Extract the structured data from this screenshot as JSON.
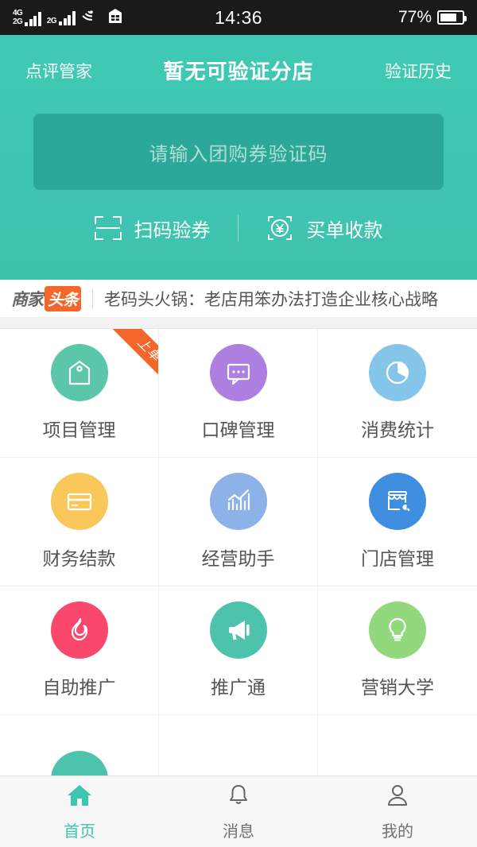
{
  "statusbar": {
    "sim1_label": "4G",
    "sim2_label": "2G",
    "sim3_label": "2G",
    "time": "14:36",
    "battery_percent": "77%",
    "battery_level": 75,
    "wifi_icon": "wifi-icon",
    "alarm_icon": "building-icon"
  },
  "header": {
    "left_label": "点评管家",
    "title": "暂无可验证分店",
    "right_label": "验证历史",
    "input": {
      "value": "",
      "placeholder": "请输入团购券验证码"
    },
    "actions": [
      {
        "label": "扫码验券",
        "icon": "scan-code-icon"
      },
      {
        "label": "买单收款",
        "icon": "yuan-scan-icon"
      }
    ],
    "bg_color": "#3ec6b0",
    "input_bg_color": "#2ba89a"
  },
  "news": {
    "logo_part1": "商家",
    "logo_part2": "头条",
    "logo_accent_color": "#f4662a",
    "headline": "老码头火锅：老店用笨办法打造企业核心战略"
  },
  "grid": {
    "items": [
      {
        "label": "项目管理",
        "icon": "price-tag-icon",
        "color": "#5bc6aa",
        "badge": "上单"
      },
      {
        "label": "口碑管理",
        "icon": "speech-bubble-icon",
        "color": "#ac7fe0",
        "badge": ""
      },
      {
        "label": "消费统计",
        "icon": "pie-chart-icon",
        "color": "#86c5ea",
        "badge": ""
      },
      {
        "label": "财务结款",
        "icon": "credit-card-icon",
        "color": "#fac košice",
        "badge": ""
      },
      {
        "label": "经营助手",
        "icon": "bar-chart-icon",
        "color": "#8cb2e8",
        "badge": ""
      },
      {
        "label": "门店管理",
        "icon": "storefront-wrench-icon",
        "color": "#3f8ee0",
        "badge": ""
      },
      {
        "label": "自助推广",
        "icon": "flame-icon",
        "color": "#f9486b",
        "badge": ""
      },
      {
        "label": "推广通",
        "icon": "megaphone-icon",
        "color": "#4ec3ab",
        "badge": ""
      },
      {
        "label": "营销大学",
        "icon": "lightbulb-icon",
        "color": "#92d островах",
        "badge": ""
      }
    ],
    "partial_row_icon_color": "#4ec3ab"
  },
  "tabbar": {
    "items": [
      {
        "label": "首页",
        "icon": "home-icon",
        "active": true
      },
      {
        "label": "消息",
        "icon": "bell-icon",
        "active": false
      },
      {
        "label": "我的",
        "icon": "person-icon",
        "active": false
      }
    ],
    "active_color": "#3ec6b0"
  }
}
